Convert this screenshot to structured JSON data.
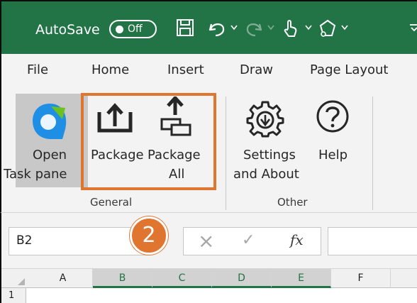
{
  "titlebar": {
    "autosave_label": "AutoSave",
    "autosave_state": "Off",
    "bg_color": "#227447"
  },
  "tabs": [
    {
      "label": "File"
    },
    {
      "label": "Home"
    },
    {
      "label": "Insert"
    },
    {
      "label": "Draw"
    },
    {
      "label": "Page Layout"
    }
  ],
  "ribbon": {
    "open_pane": {
      "line1": "Open",
      "line2": "Task pane"
    },
    "package": {
      "label": "Package"
    },
    "package_all": {
      "line1": "Package",
      "line2": "All"
    },
    "settings": {
      "line1": "Settings",
      "line2": "and About"
    },
    "help": {
      "label": "Help"
    },
    "groups": {
      "general": "General",
      "other": "Other"
    }
  },
  "formula_bar": {
    "namebox_value": "B2",
    "cancel_icon": "×",
    "enter_icon": "✓",
    "fx_label": "fx"
  },
  "badge": {
    "number": "2",
    "color": "#e07530"
  },
  "grid": {
    "columns": [
      "A",
      "B",
      "C",
      "D",
      "E",
      "F"
    ],
    "rows": [
      "1"
    ]
  }
}
